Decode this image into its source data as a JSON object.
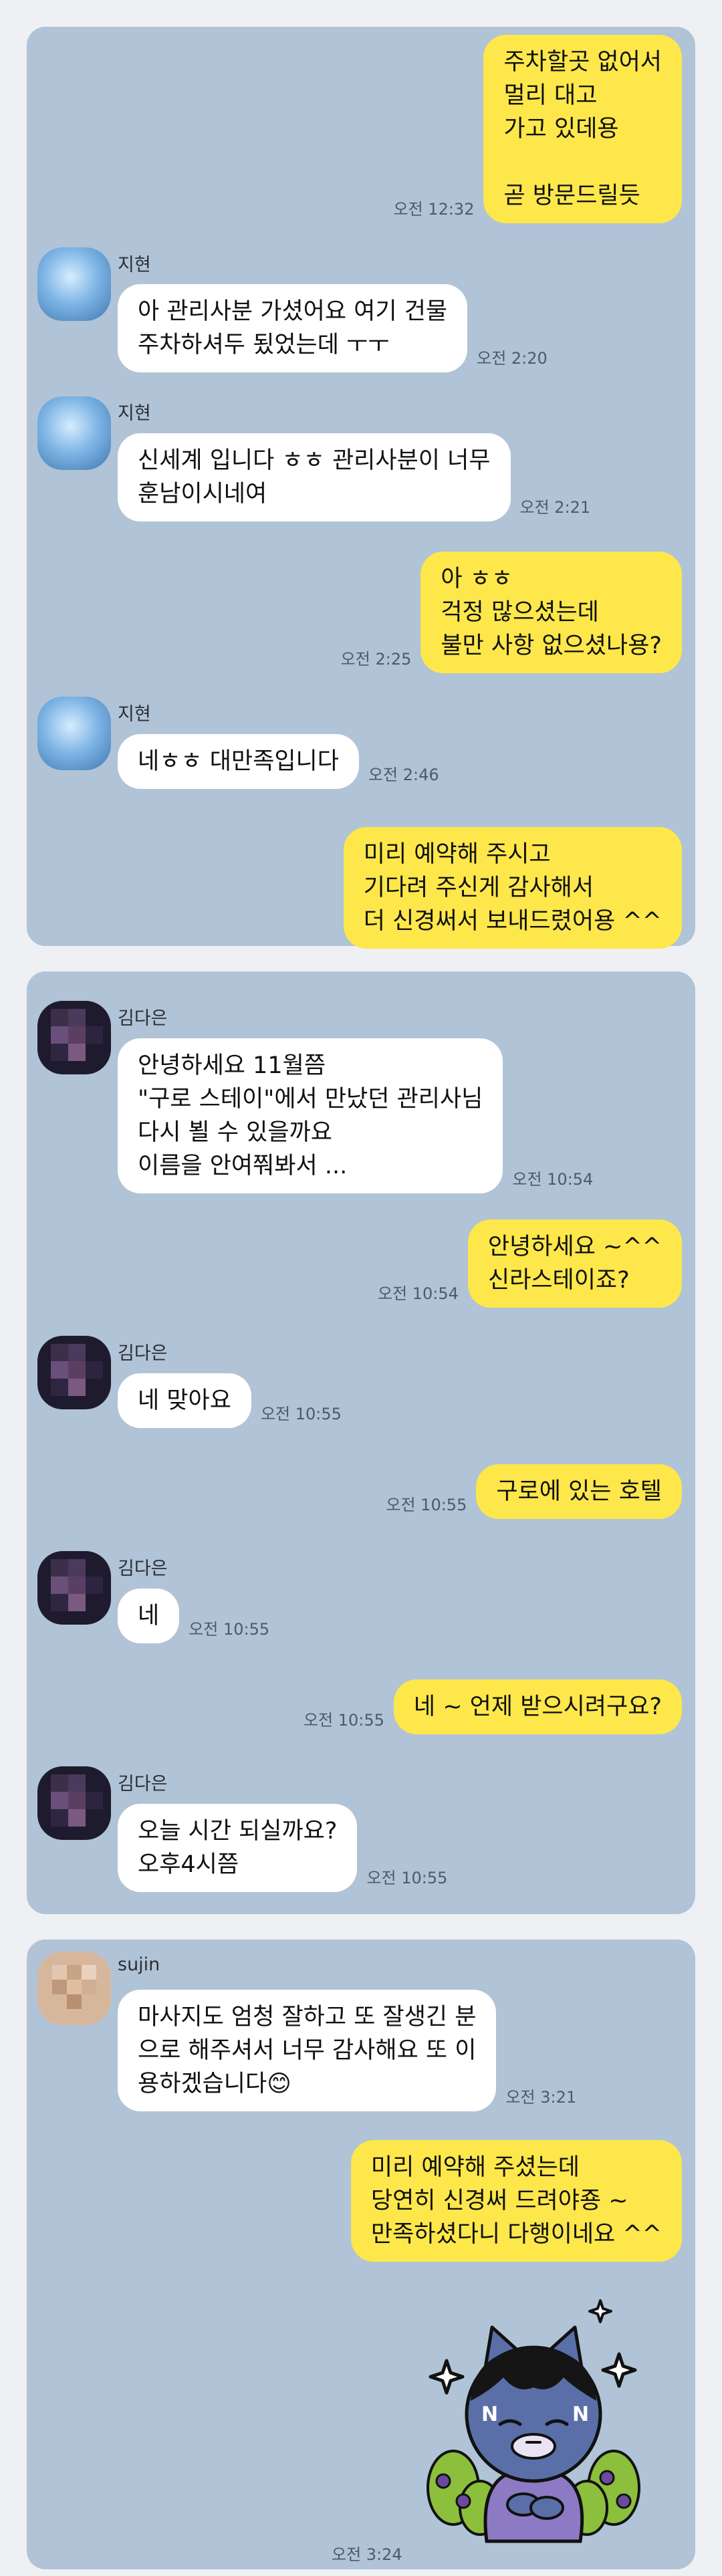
{
  "contacts": {
    "jihyeon": "지현",
    "kimdaeun": "김다은",
    "sujin": "sujin"
  },
  "panel1": [
    {
      "type": "out",
      "text": "주차할곳 없어서\n멀리 대고\n가고 있데용\n\n곧 방문드릴듯",
      "time": "오전 12:32"
    },
    {
      "type": "in",
      "text": "아 관리사분 가셨어요 여기 건물\n주차하셔두 됬었는데 ㅜㅜ",
      "time": "오전 2:20"
    },
    {
      "type": "in",
      "text": "신세계 입니다 ㅎㅎ 관리사분이 너무\n훈남이시네여",
      "time": "오전 2:21"
    },
    {
      "type": "out",
      "text": "아 ㅎㅎ\n걱정 많으셨는데\n불만 사항 없으셨나용?",
      "time": "오전 2:25"
    },
    {
      "type": "in",
      "text": "네ㅎㅎ 대만족입니다",
      "time": "오전 2:46"
    },
    {
      "type": "out",
      "text": "미리 예약해 주시고\n기다려 주신게 감사해서\n더 신경써서 보내드렸어용 ^^",
      "time": ""
    }
  ],
  "panel2": [
    {
      "type": "in",
      "text": "안녕하세요 11월쯤\n\"구로 스테이\"에서 만났던 관리사님\n다시 뵐 수 있을까요\n이름을 안여쭤봐서 ...",
      "time": "오전 10:54"
    },
    {
      "type": "out",
      "text": "안녕하세요 ~^^\n신라스테이죠?",
      "time": "오전 10:54"
    },
    {
      "type": "in",
      "text": "네 맞아요",
      "time": "오전 10:55"
    },
    {
      "type": "out",
      "text": "구로에 있는 호텔",
      "time": "오전 10:55"
    },
    {
      "type": "in",
      "text": "네",
      "time": "오전 10:55"
    },
    {
      "type": "out",
      "text": "네 ~ 언제 받으시려구요?",
      "time": "오전 10:55"
    },
    {
      "type": "in",
      "text": "오늘  시간 되실까요?\n오후4시쯤",
      "time": "오전 10:55"
    }
  ],
  "panel3": [
    {
      "type": "in",
      "text": "마사지도 엄청 잘하고 또 잘생긴 분\n으로 해주셔서 너무 감사해요 또 이\n용하겠습니다😊",
      "time": "오전 3:21"
    },
    {
      "type": "out",
      "text": "미리 예약해 주셨는데\n당연히 신경써 드려야죵 ~\n만족하셨다니 다행이네요 ^^",
      "time": ""
    }
  ],
  "sticker_time": "오전 3:24",
  "sticker_icon": "kakao-friends-character-sticker",
  "colors": {
    "panel": "#b1c3d6",
    "outgoing": "#fde74b",
    "incoming": "#ffffff"
  }
}
